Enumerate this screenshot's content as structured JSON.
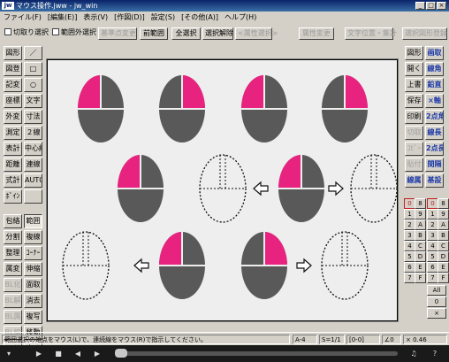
{
  "window": {
    "app_icon": "jw",
    "title": "マウス操作.jww - jw_win",
    "minimize": "_",
    "maximize": "□",
    "close": "×"
  },
  "menu": [
    "ファイル(F)",
    "[編集(E)]",
    "表示(V)",
    "[作図(D)]",
    "設定(S)",
    "[その他(A)]",
    "ヘルプ(H)"
  ],
  "toolbar": {
    "cut_select": "切取り選択",
    "outside_select": "範囲外選択",
    "base_change": "基準点変更",
    "prev_range": "前範囲",
    "select_all": "全選択",
    "deselect": "選択解除",
    "attr_select": "<属性選択>",
    "attr_change": "属性変更",
    "text_pos": "文字位置・集計",
    "select_figure_register": "選択図形登録"
  },
  "left_tools": [
    [
      "図形",
      "／"
    ],
    [
      "図登",
      "□"
    ],
    [
      "記変",
      "○"
    ],
    [
      "座標",
      "文字"
    ],
    [
      "外変",
      "寸法"
    ],
    [
      "測定",
      "２線"
    ],
    [
      "表計",
      "中心線"
    ],
    [
      "距離",
      "連線"
    ],
    [
      "式計",
      "AUTO"
    ],
    [
      "ﾎﾞｲﾝ",
      ""
    ],
    [
      "包絡",
      "範囲"
    ],
    [
      "分割",
      "複線"
    ],
    [
      "整理",
      "ｺｰﾅｰ"
    ],
    [
      "属変",
      "伸縮"
    ],
    [
      "BL化",
      "面取"
    ],
    [
      "BL解",
      "消去"
    ],
    [
      "BL属",
      "複写"
    ],
    [
      "BL編",
      "移動"
    ],
    [
      "BL終",
      "戻る"
    ]
  ],
  "right_tools": [
    [
      "図形",
      "画取"
    ],
    [
      "開く",
      "線角"
    ],
    [
      "上書",
      "鉛直"
    ],
    [
      "保存",
      "×軸"
    ],
    [
      "印刷",
      "2点角"
    ],
    [
      "切取",
      "線長"
    ],
    [
      "ｺﾋﾟｰ",
      "2点長"
    ],
    [
      "貼付",
      "間隔"
    ],
    [
      "線属",
      "基設"
    ]
  ],
  "layer_buttons": [
    [
      "0",
      "8",
      "0",
      "8"
    ],
    [
      "1",
      "9",
      "1",
      "9"
    ],
    [
      "2",
      "A",
      "2",
      "A"
    ],
    [
      "3",
      "B",
      "3",
      "B"
    ],
    [
      "4",
      "C",
      "4",
      "C"
    ],
    [
      "5",
      "D",
      "5",
      "D"
    ],
    [
      "6",
      "E",
      "6",
      "E"
    ],
    [
      "7",
      "F",
      "7",
      "F"
    ]
  ],
  "layer_all": "All",
  "layer_zero": "0",
  "layer_x": "×",
  "status": {
    "message": "範囲選択の始点をマウス(L)で、連続線をマウス(R)で指示してください。",
    "paper": "A-4",
    "scale": "S=1/1",
    "layer": "[0-0]",
    "angle": "∠0",
    "zoom": "× 0.46"
  },
  "media": {
    "icons": [
      "play-icon",
      "stop-icon",
      "prev-icon",
      "next-icon",
      "music-icon",
      "help-icon"
    ]
  },
  "colors": {
    "accent": "#e8237f",
    "mouse_body": "#595959",
    "canvas_bg": "#eeeeee"
  }
}
